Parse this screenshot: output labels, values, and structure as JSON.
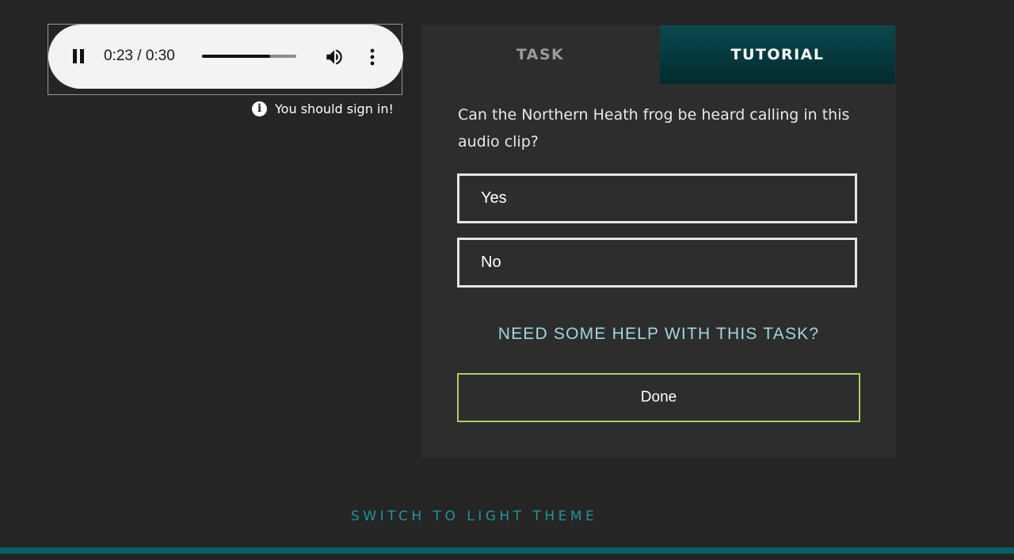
{
  "audio": {
    "time_display": "0:23 / 0:30",
    "progress": 0.72
  },
  "notice": {
    "sign_in_text": "You should sign in!"
  },
  "tabs": {
    "task_label": "TASK",
    "tutorial_label": "TUTORIAL"
  },
  "task": {
    "question": "Can the Northern Heath frog be heard calling in this audio clip?",
    "answers": [
      {
        "label": "Yes"
      },
      {
        "label": "No"
      }
    ],
    "help_link": "NEED SOME HELP WITH THIS TASK?",
    "done_label": "Done"
  },
  "footer": {
    "theme_switch": "SWITCH TO LIGHT THEME"
  },
  "colors": {
    "background": "#252525",
    "panel": "#2d2d2d",
    "tutorial_tab": "#04363b",
    "help_link": "#9fd7e0",
    "done_border": "#a6d45a",
    "theme_link": "#1b96a1",
    "bottom_bar": "#0b5d68"
  }
}
